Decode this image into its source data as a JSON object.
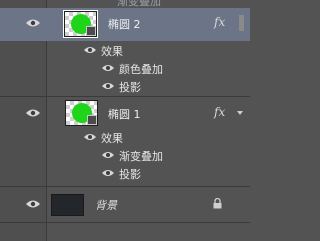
{
  "top_partial_label": "渐变叠加",
  "layers": [
    {
      "name": "椭圆 2",
      "selected": true,
      "fx": "fx",
      "effects_title": "效果",
      "effects": [
        "颜色叠加",
        "投影"
      ]
    },
    {
      "name": "椭圆 1",
      "selected": false,
      "fx": "fx",
      "effects_title": "效果",
      "effects": [
        "渐变叠加",
        "投影"
      ]
    }
  ],
  "background_layer": {
    "name": "背景"
  },
  "colors": {
    "panel_bg": "#535353",
    "selected_row": "#6b7587",
    "shape_fill": "#1ed51a",
    "background_fill": "#23272c"
  },
  "icons": {
    "visibility": "eye-icon",
    "lock": "lock-icon",
    "fx": "fx-icon"
  }
}
